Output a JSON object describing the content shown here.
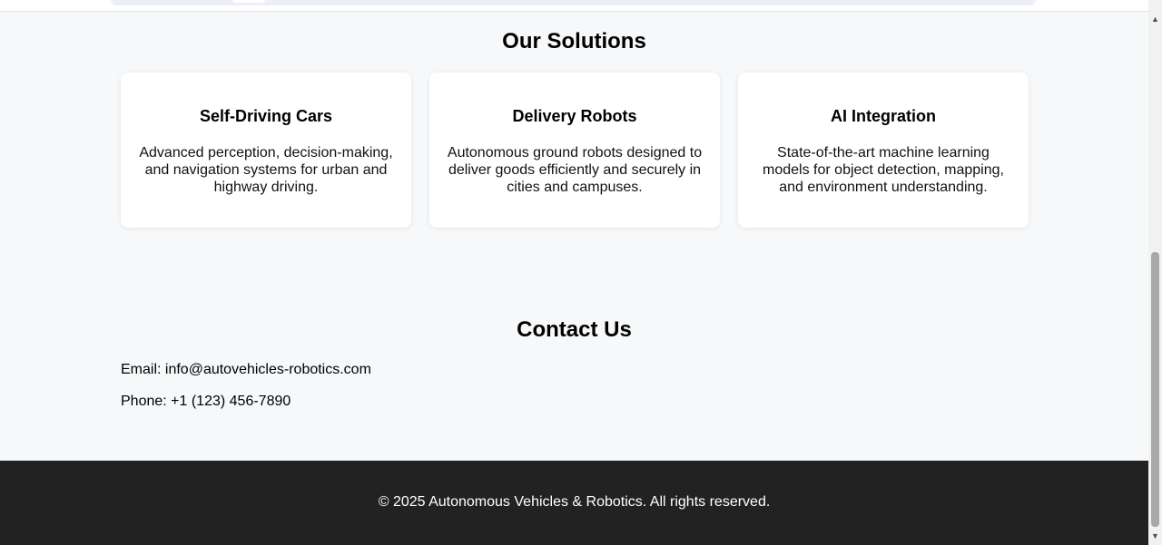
{
  "solutions": {
    "title": "Our Solutions",
    "cards": [
      {
        "title": "Self-Driving Cars",
        "description": "Advanced perception, decision-making, and navigation systems for urban and highway driving."
      },
      {
        "title": "Delivery Robots",
        "description": "Autonomous ground robots designed to deliver goods efficiently and securely in cities and campuses."
      },
      {
        "title": "AI Integration",
        "description": "State-of-the-art machine learning models for object detection, mapping, and environment understanding."
      }
    ]
  },
  "contact": {
    "title": "Contact Us",
    "email": "Email: info@autovehicles-robotics.com",
    "phone": "Phone: +1 (123) 456-7890"
  },
  "footer": {
    "copyright": "© 2025 Autonomous Vehicles & Robotics. All rights reserved."
  },
  "colors": {
    "page_background": "#f6f8fa",
    "card_background": "#ffffff",
    "footer_background": "#222222",
    "footer_text": "#ffffff"
  },
  "icons": {
    "scroll_up": "scroll-up-arrow-icon",
    "scroll_down": "scroll-down-arrow-icon"
  }
}
